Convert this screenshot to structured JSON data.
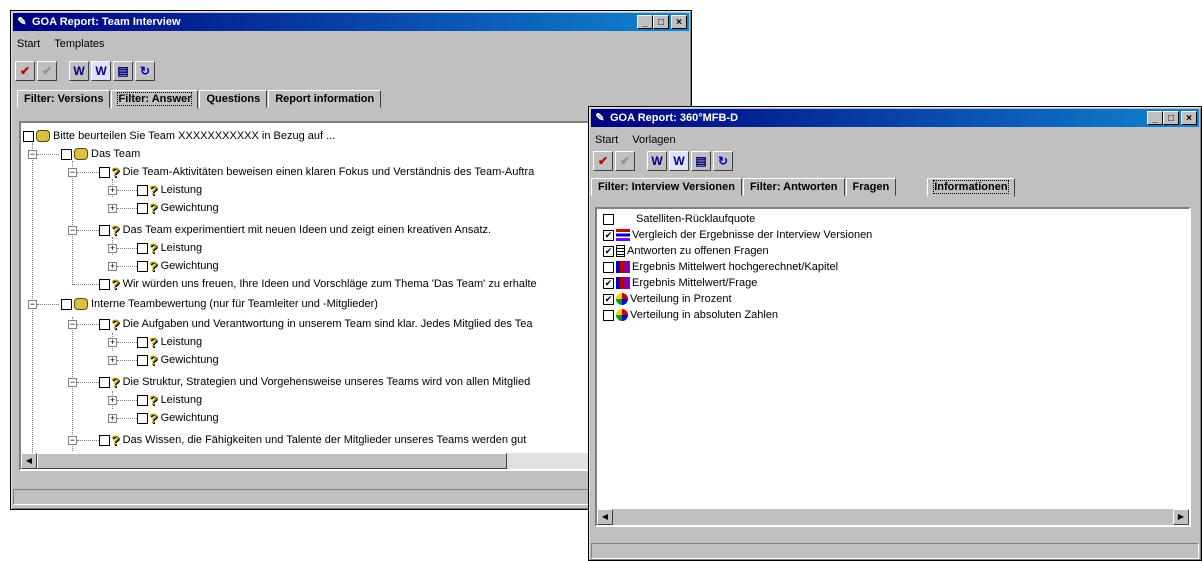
{
  "win1": {
    "title": "GOA Report: Team Interview",
    "menu": [
      "Start",
      "Templates"
    ],
    "tabs": [
      "Filter: Versions",
      "Filter: Answer",
      "Questions",
      "Report information"
    ],
    "tree": [
      "Bitte beurteilen Sie Team XXXXXXXXXXX in Bezug auf ...",
      "Das Team",
      "Die Team-Aktivitäten beweisen einen klaren Fokus und Verständnis des Team-Auftra",
      "Leistung",
      "Gewichtung",
      "Das Team experimentiert mit neuen Ideen und zeigt einen kreativen Ansatz.",
      "Leistung",
      "Gewichtung",
      "Wir würden uns freuen, Ihre Ideen und Vorschläge zum Thema 'Das Team' zu erhalte",
      "Interne Teambewertung (nur für Teamleiter und -Mitglieder)",
      "Die Aufgaben und Verantwortung in unserem Team sind klar. Jedes Mitglied des Tea",
      "Leistung",
      "Gewichtung",
      "Die Struktur, Strategien und Vorgehensweise unseres Teams wird von allen Mitglied",
      "Leistung",
      "Gewichtung",
      "Das Wissen, die Fähigkeiten und Talente der Mitglieder unseres Teams werden gut"
    ]
  },
  "win2": {
    "title": "GOA Report: 360°MFB-D",
    "menu": [
      "Start",
      "Vorlagen"
    ],
    "tabs": [
      "Filter: Interview Versionen",
      "Filter: Antworten",
      "Fragen",
      "Informationen"
    ],
    "items": [
      {
        "label": "Satelliten-Rücklaufquote",
        "checked": false
      },
      {
        "label": "Vergleich der Ergebnisse der Interview Versionen",
        "checked": true
      },
      {
        "label": "Antworten zu offenen Fragen",
        "checked": true
      },
      {
        "label": "Ergebnis Mittelwert hochgerechnet/Kapitel",
        "checked": false
      },
      {
        "label": "Ergebnis Mittelwert/Frage",
        "checked": true
      },
      {
        "label": "Verteilung in Prozent",
        "checked": true
      },
      {
        "label": "Verteilung in absoluten Zahlen",
        "checked": false
      }
    ]
  }
}
